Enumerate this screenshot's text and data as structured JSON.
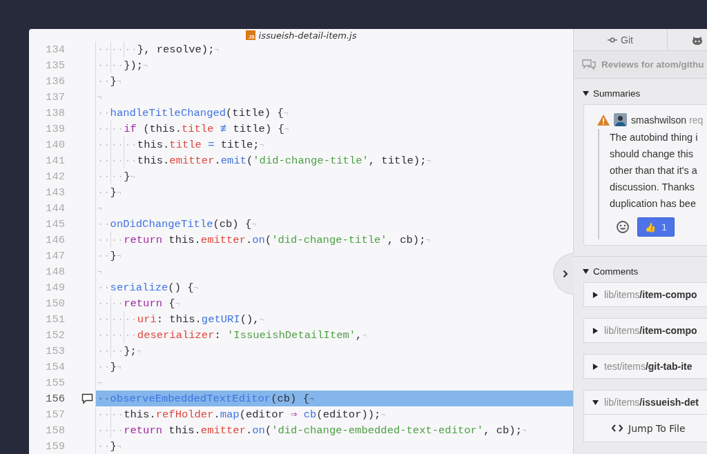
{
  "editor": {
    "tab_title": "issueish-detail-item.js",
    "tab_icon_label": "JS",
    "lines": [
      {
        "number": "134",
        "indent": "······",
        "tokens": [
          {
            "kind": "plain",
            "text": "}, resolve);"
          }
        ],
        "eol": "¬",
        "selected": false,
        "commented": false
      },
      {
        "number": "135",
        "indent": "····",
        "tokens": [
          {
            "kind": "plain",
            "text": "});"
          }
        ],
        "eol": "¬",
        "selected": false,
        "commented": false
      },
      {
        "number": "136",
        "indent": "··",
        "tokens": [
          {
            "kind": "plain",
            "text": "}"
          }
        ],
        "eol": "¬",
        "selected": false,
        "commented": false
      },
      {
        "number": "137",
        "eol": "¬",
        "selected": false,
        "commented": false
      },
      {
        "number": "138",
        "indent": "··",
        "tokens": [
          {
            "kind": "function",
            "text": "handleTitleChanged"
          },
          {
            "kind": "plain",
            "text": "(title) {"
          }
        ],
        "eol": "¬",
        "selected": false,
        "commented": false
      },
      {
        "number": "139",
        "indent": "····",
        "tokens": [
          {
            "kind": "keyword",
            "text": "if"
          },
          {
            "kind": "plain",
            "text": " (this."
          },
          {
            "kind": "property",
            "text": "title"
          },
          {
            "kind": "operator",
            "text": " ≢"
          },
          {
            "kind": "plain",
            "text": " title) {"
          }
        ],
        "eol": "¬",
        "selected": false,
        "commented": false
      },
      {
        "number": "140",
        "indent": "······",
        "tokens": [
          {
            "kind": "plain",
            "text": "this."
          },
          {
            "kind": "property",
            "text": "title"
          },
          {
            "kind": "operator",
            "text": " ="
          },
          {
            "kind": "plain",
            "text": " title;"
          }
        ],
        "eol": "¬",
        "selected": false,
        "commented": false
      },
      {
        "number": "141",
        "indent": "······",
        "tokens": [
          {
            "kind": "plain",
            "text": "this."
          },
          {
            "kind": "property",
            "text": "emitter"
          },
          {
            "kind": "plain",
            "text": "."
          },
          {
            "kind": "function",
            "text": "emit"
          },
          {
            "kind": "plain",
            "text": "("
          },
          {
            "kind": "string",
            "text": "'did-change-title'"
          },
          {
            "kind": "plain",
            "text": ", title);"
          }
        ],
        "eol": "¬",
        "selected": false,
        "commented": false
      },
      {
        "number": "142",
        "indent": "····",
        "tokens": [
          {
            "kind": "plain",
            "text": "}"
          }
        ],
        "eol": "¬",
        "selected": false,
        "commented": false
      },
      {
        "number": "143",
        "indent": "··",
        "tokens": [
          {
            "kind": "plain",
            "text": "}"
          }
        ],
        "eol": "¬",
        "selected": false,
        "commented": false
      },
      {
        "number": "144",
        "eol": "¬",
        "selected": false,
        "commented": false
      },
      {
        "number": "145",
        "indent": "··",
        "tokens": [
          {
            "kind": "function",
            "text": "onDidChangeTitle"
          },
          {
            "kind": "plain",
            "text": "(cb) {"
          }
        ],
        "eol": "¬",
        "selected": false,
        "commented": false
      },
      {
        "number": "146",
        "indent": "····",
        "tokens": [
          {
            "kind": "keyword",
            "text": "return"
          },
          {
            "kind": "plain",
            "text": " this."
          },
          {
            "kind": "property",
            "text": "emitter"
          },
          {
            "kind": "plain",
            "text": "."
          },
          {
            "kind": "function",
            "text": "on"
          },
          {
            "kind": "plain",
            "text": "("
          },
          {
            "kind": "string",
            "text": "'did-change-title'"
          },
          {
            "kind": "plain",
            "text": ", cb);"
          }
        ],
        "eol": "¬",
        "selected": false,
        "commented": false
      },
      {
        "number": "147",
        "indent": "··",
        "tokens": [
          {
            "kind": "plain",
            "text": "}"
          }
        ],
        "eol": "¬",
        "selected": false,
        "commented": false
      },
      {
        "number": "148",
        "eol": "¬",
        "selected": false,
        "commented": false
      },
      {
        "number": "149",
        "indent": "··",
        "tokens": [
          {
            "kind": "function",
            "text": "serialize"
          },
          {
            "kind": "plain",
            "text": "() {"
          }
        ],
        "eol": "¬",
        "selected": false,
        "commented": false
      },
      {
        "number": "150",
        "indent": "····",
        "tokens": [
          {
            "kind": "keyword",
            "text": "return"
          },
          {
            "kind": "plain",
            "text": " {"
          }
        ],
        "eol": "¬",
        "selected": false,
        "commented": false
      },
      {
        "number": "151",
        "indent": "······",
        "tokens": [
          {
            "kind": "property",
            "text": "uri"
          },
          {
            "kind": "plain",
            "text": ": this."
          },
          {
            "kind": "function",
            "text": "getURI"
          },
          {
            "kind": "plain",
            "text": "(),"
          }
        ],
        "eol": "¬",
        "selected": false,
        "commented": false
      },
      {
        "number": "152",
        "indent": "······",
        "tokens": [
          {
            "kind": "property",
            "text": "deserializer"
          },
          {
            "kind": "plain",
            "text": ": "
          },
          {
            "kind": "string",
            "text": "'IssueishDetailItem'"
          },
          {
            "kind": "plain",
            "text": ","
          }
        ],
        "eol": "¬",
        "selected": false,
        "commented": false
      },
      {
        "number": "153",
        "indent": "····",
        "tokens": [
          {
            "kind": "plain",
            "text": "};"
          }
        ],
        "eol": "¬",
        "selected": false,
        "commented": false
      },
      {
        "number": "154",
        "indent": "··",
        "tokens": [
          {
            "kind": "plain",
            "text": "}"
          }
        ],
        "eol": "¬",
        "selected": false,
        "commented": false
      },
      {
        "number": "155",
        "eol": "¬",
        "selected": false,
        "commented": false
      },
      {
        "number": "156",
        "indent": "··",
        "tokens": [
          {
            "kind": "function",
            "text": "observeEmbeddedTextEditor"
          },
          {
            "kind": "plain",
            "text": "(cb) {"
          }
        ],
        "eol": "¬",
        "selected": true,
        "commented": true
      },
      {
        "number": "157",
        "indent": "····",
        "tokens": [
          {
            "kind": "plain",
            "text": "this."
          },
          {
            "kind": "property",
            "text": "refHolder"
          },
          {
            "kind": "plain",
            "text": "."
          },
          {
            "kind": "function",
            "text": "map"
          },
          {
            "kind": "plain",
            "text": "(editor "
          },
          {
            "kind": "keyword",
            "text": "⇒"
          },
          {
            "kind": "function",
            "text": " cb"
          },
          {
            "kind": "plain",
            "text": "(editor));"
          }
        ],
        "eol": "¬",
        "selected": false,
        "commented": false
      },
      {
        "number": "158",
        "indent": "····",
        "tokens": [
          {
            "kind": "keyword",
            "text": "return"
          },
          {
            "kind": "plain",
            "text": " this."
          },
          {
            "kind": "property",
            "text": "emitter"
          },
          {
            "kind": "plain",
            "text": "."
          },
          {
            "kind": "function",
            "text": "on"
          },
          {
            "kind": "plain",
            "text": "("
          },
          {
            "kind": "string",
            "text": "'did-change-embedded-text-editor'"
          },
          {
            "kind": "plain",
            "text": ", cb);"
          }
        ],
        "eol": "¬",
        "selected": false,
        "commented": false
      },
      {
        "number": "159",
        "indent": "··",
        "tokens": [
          {
            "kind": "plain",
            "text": "}"
          }
        ],
        "eol": "¬",
        "selected": false,
        "commented": false
      }
    ]
  },
  "sidebar": {
    "tabs": [
      {
        "label": "Git",
        "kind": "git",
        "selected": false
      },
      {
        "kind": "github",
        "selected": false
      }
    ],
    "header": "Reviews for atom/githu",
    "summaries": {
      "title": "Summaries",
      "expanded": true,
      "author": "smashwilson",
      "action": "req",
      "body_lines": [
        "The autobind thing i",
        "should change this",
        "other than that it's a",
        "discussion. Thanks",
        "duplication has bee"
      ],
      "reaction": {
        "emoji": "👍",
        "count": "1"
      }
    },
    "comments": {
      "title": "Comments",
      "expanded": true,
      "files": [
        {
          "dir": "lib/items",
          "name": "/item-compo",
          "expanded": false
        },
        {
          "dir": "lib/items",
          "name": "/item-compo",
          "expanded": false
        },
        {
          "dir": "test/items",
          "name": "/git-tab-ite",
          "expanded": false
        },
        {
          "dir": "lib/items",
          "name": "/issueish-det",
          "expanded": true
        }
      ],
      "jump_label": "Jump To File"
    }
  }
}
